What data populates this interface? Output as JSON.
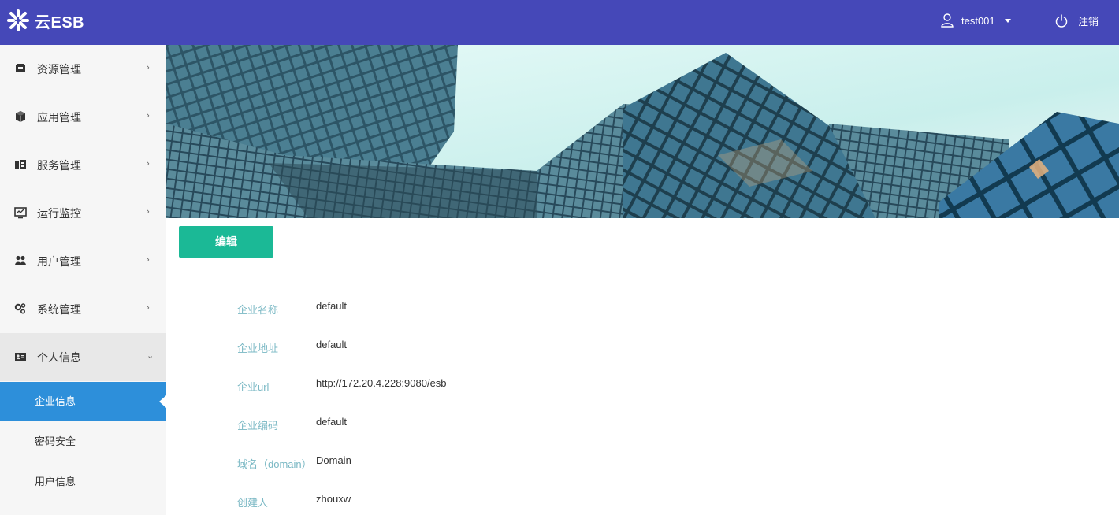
{
  "app": {
    "title": "云ESB"
  },
  "header": {
    "username": "test001",
    "logout_label": "注销"
  },
  "sidebar": {
    "items": [
      {
        "label": "资源管理",
        "icon": "inbox-icon",
        "arrow": "›"
      },
      {
        "label": "应用管理",
        "icon": "cube-icon",
        "arrow": "›"
      },
      {
        "label": "服务管理",
        "icon": "services-icon",
        "arrow": "›"
      },
      {
        "label": "运行监控",
        "icon": "monitor-icon",
        "arrow": "›"
      },
      {
        "label": "用户管理",
        "icon": "users-icon",
        "arrow": "›"
      },
      {
        "label": "系统管理",
        "icon": "gears-icon",
        "arrow": "›"
      },
      {
        "label": "个人信息",
        "icon": "id-card-icon",
        "arrow": "⌄",
        "expanded": true
      }
    ],
    "subitems": [
      {
        "label": "企业信息",
        "active": true
      },
      {
        "label": "密码安全",
        "active": false
      },
      {
        "label": "用户信息",
        "active": false
      }
    ]
  },
  "main": {
    "edit_label": "编辑",
    "fields": [
      {
        "label": "企业名称",
        "value": "default"
      },
      {
        "label": "企业地址",
        "value": "default"
      },
      {
        "label": "企业url",
        "value": "http://172.20.4.228:9080/esb"
      },
      {
        "label": "企业编码",
        "value": "default"
      },
      {
        "label": "域名（domain）",
        "value": "Domain"
      },
      {
        "label": "创建人",
        "value": "zhouxw"
      }
    ]
  },
  "colors": {
    "header_bg": "#4548b8",
    "sidebar_bg": "#f6f6f6",
    "active_item": "#2d8fda",
    "edit_button": "#1bb996",
    "field_label": "#7ab8c4"
  }
}
